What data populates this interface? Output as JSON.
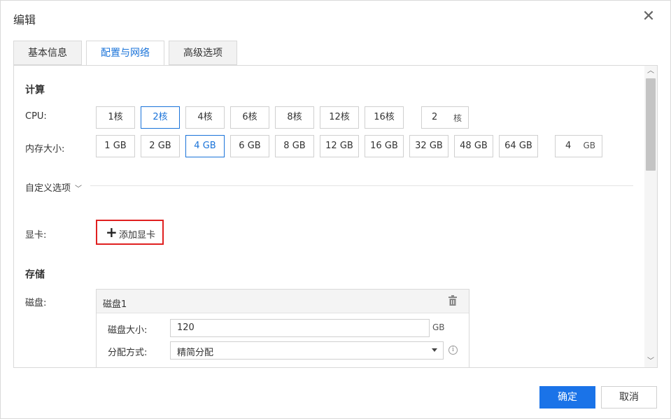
{
  "dialog": {
    "title": "编辑"
  },
  "tabs": [
    {
      "label": "基本信息",
      "active": false
    },
    {
      "label": "配置与网络",
      "active": true
    },
    {
      "label": "高级选项",
      "active": false
    }
  ],
  "compute": {
    "title": "计算",
    "cpu": {
      "label": "CPU:",
      "options": [
        "1核",
        "2核",
        "4核",
        "6核",
        "8核",
        "12核",
        "16核"
      ],
      "selected": "2核",
      "custom_value": "2",
      "custom_unit": "核"
    },
    "memory": {
      "label": "内存大小:",
      "options": [
        "1 GB",
        "2 GB",
        "4 GB",
        "6 GB",
        "8 GB",
        "12 GB",
        "16 GB",
        "32 GB",
        "48 GB",
        "64 GB"
      ],
      "selected": "4 GB",
      "custom_value": "4",
      "custom_unit": "GB"
    },
    "custom_options_label": "自定义选项"
  },
  "gpu": {
    "label": "显卡:",
    "add_label": "添加显卡"
  },
  "storage": {
    "title": "存储",
    "disk_label": "磁盘:",
    "disks": [
      {
        "name": "磁盘1",
        "size_label": "磁盘大小:",
        "size_value": "120",
        "size_unit": "GB",
        "alloc_label": "分配方式:",
        "alloc_value": "精简分配"
      }
    ]
  },
  "footer": {
    "ok_label": "确定",
    "cancel_label": "取消"
  },
  "colors": {
    "accent": "#1a73e8",
    "highlight_border": "#e02020"
  }
}
